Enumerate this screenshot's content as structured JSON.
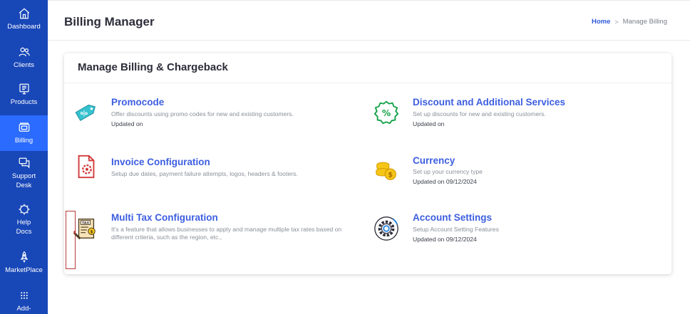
{
  "sidebar": {
    "items": [
      {
        "label": "Dashboard",
        "icon": "home-icon"
      },
      {
        "label": "Clients",
        "icon": "users-icon"
      },
      {
        "label": "Products",
        "icon": "monitor-icon"
      },
      {
        "label": "Billing",
        "icon": "billing-icon"
      },
      {
        "label": "Support",
        "label2": "Desk",
        "icon": "chat-icon"
      },
      {
        "label": "Help",
        "label2": "Docs",
        "icon": "lifebuoy-icon"
      },
      {
        "label": "MarketPlace",
        "icon": "rocket-icon"
      },
      {
        "label": "Add-",
        "icon": "apps-grid-icon"
      }
    ],
    "active": "Billing",
    "colors": {
      "background": "#1847b8",
      "active": "#2b6bff"
    }
  },
  "header": {
    "title": "Billing Manager",
    "breadcrumb": {
      "home": "Home",
      "separator": ">",
      "current": "Manage Billing"
    }
  },
  "card": {
    "title": "Manage Billing & Chargeback",
    "tiles": [
      {
        "title": "Promocode",
        "desc": "Offer discounts using promo codes for new and existing customers.",
        "updated": "Updated on",
        "icon": "promo-tag-icon"
      },
      {
        "title": "Discount and Additional Services",
        "desc": "Set up discounts for new and existing customers.",
        "updated": "Updated on",
        "icon": "discount-badge-icon"
      },
      {
        "title": "Invoice Configuration",
        "desc": "Setup due dates, payment failure attempts, logos, headers & footers.",
        "updated": "",
        "icon": "invoice-gear-icon"
      },
      {
        "title": "Currency",
        "desc": "Set up your currency type",
        "updated": "Updated on 09/12/2024",
        "icon": "coins-icon"
      },
      {
        "title": "Multi Tax Configuration",
        "desc": "It's a feature that allows businesses to apply and manage multiple tax rates based on different criteria, such as the region, etc.,",
        "updated": "",
        "icon": "tax-document-icon",
        "tax_text": "TAX"
      },
      {
        "title": "Account Settings",
        "desc": "Setup Account Setting Features",
        "updated": "Updated on 09/12/2024",
        "icon": "settings-gear-icon"
      }
    ]
  },
  "accent_color": "#3d5ee0"
}
